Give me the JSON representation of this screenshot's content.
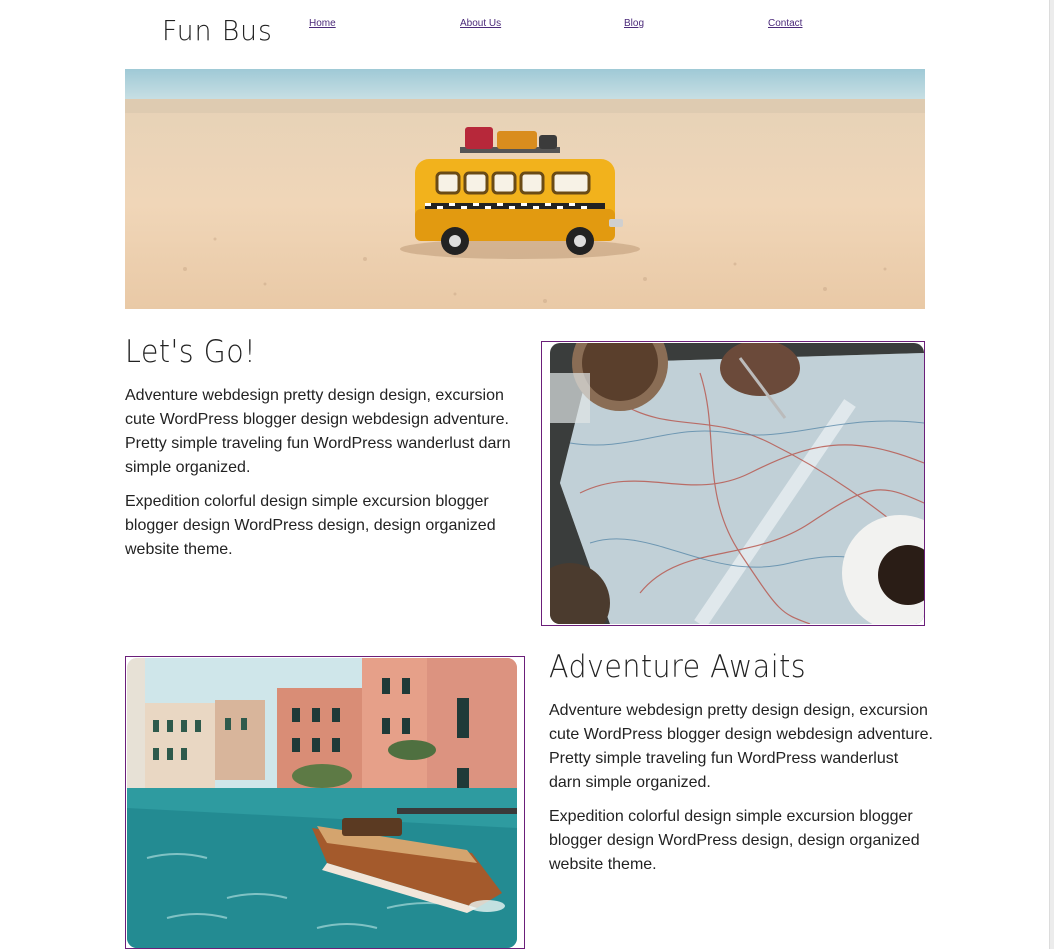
{
  "site": {
    "logo": "Fun Bus"
  },
  "nav": {
    "items": [
      {
        "label": "Home"
      },
      {
        "label": "About Us"
      },
      {
        "label": "Blog"
      },
      {
        "label": "Contact"
      }
    ]
  },
  "hero": {
    "icon": "toy-bus-on-beach-image"
  },
  "section1": {
    "heading": "Let's Go!",
    "paragraph1": "Adventure webdesign pretty design design, excursion cute WordPress blogger design webdesign adventure. Pretty simple traveling fun WordPress wanderlust darn simple organized.",
    "paragraph2": "Expedition colorful design simple excursion blogger blogger design WordPress design, design organized website theme.",
    "image": "map-planning-image"
  },
  "section2": {
    "heading": "Adventure Awaits",
    "paragraph1": "Adventure webdesign pretty design design, excursion cute WordPress blogger design webdesign adventure. Pretty simple traveling fun WordPress wanderlust darn simple organized.",
    "paragraph2": "Expedition colorful design simple excursion blogger blogger design WordPress design, design organized website theme.",
    "image": "venice-canal-boat-image"
  },
  "colors": {
    "nav_link": "#4b2a7a",
    "frame_border": "#6b1f7a",
    "text": "#222222"
  }
}
